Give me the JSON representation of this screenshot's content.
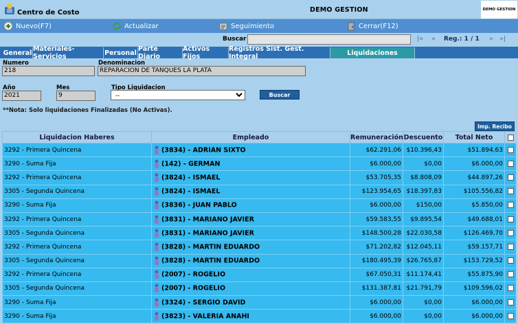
{
  "window": {
    "title": "Centro de Costo",
    "center_title": "DEMO GESTION",
    "brand": "DEMO GESTION"
  },
  "toolbar": {
    "nuevo": "Nuevo(F7)",
    "actualizar": "Actualizar",
    "seguimiento": "Seguimiento",
    "cerrar": "Cerrar(F12)"
  },
  "search": {
    "label": "Buscar",
    "value": "",
    "first": "|«",
    "prev": "«",
    "next": "»",
    "last": "»|",
    "reg": "Reg.: 1 / 1"
  },
  "tabs": [
    "General",
    "Materiales-Servicios",
    "Personal",
    "Parte Diario",
    "Activos Fijos",
    "Registros Sist. Gest. Integral",
    "Liquidaciones"
  ],
  "form": {
    "numero_label": "Numero",
    "numero": "218",
    "denominacion_label": "Denominacion",
    "denominacion": "REPARACION DE TANQUES LA PLATA",
    "anio_label": "Año",
    "anio": "2021",
    "mes_label": "Mes",
    "mes": "9",
    "tipo_label": "Tipo Liquidacion",
    "tipo": "--",
    "buscar": "Buscar",
    "nota": "**Nota: Solo liquidaciones Finalizadas (No Activas).",
    "imp_recibo": "Imp. Recibo"
  },
  "table": {
    "headers": [
      "Liquidacion Haberes",
      "Empleado",
      "Remuneración",
      "Descuento",
      "Total Neto"
    ],
    "rows": [
      {
        "liq": "3292 - Primera Quincena",
        "emp": "(3834) - ADRIAN SIXTO",
        "rem": "$62.291,06",
        "desc": "$10.396,43",
        "neto": "$51.894,63"
      },
      {
        "liq": "3290 - Suma Fija",
        "emp": "(142) - GERMAN",
        "rem": "$6.000,00",
        "desc": "$0,00",
        "neto": "$6.000,00"
      },
      {
        "liq": "3292 - Primera Quincena",
        "emp": "(3824) - ISMAEL",
        "rem": "$53.705,35",
        "desc": "$8.808,09",
        "neto": "$44.897,26"
      },
      {
        "liq": "3305 - Segunda Quincena",
        "emp": "(3824) - ISMAEL",
        "rem": "$123.954,65",
        "desc": "$18.397,83",
        "neto": "$105.556,82"
      },
      {
        "liq": "3290 - Suma Fija",
        "emp": "(3836) - JUAN PABLO",
        "rem": "$6.000,00",
        "desc": "$150,00",
        "neto": "$5.850,00"
      },
      {
        "liq": "3292 - Primera Quincena",
        "emp": "(3831) - MARIANO JAVIER",
        "rem": "$59.583,55",
        "desc": "$9.895,54",
        "neto": "$49.688,01"
      },
      {
        "liq": "3305 - Segunda Quincena",
        "emp": "(3831) - MARIANO JAVIER",
        "rem": "$148.500,28",
        "desc": "$22.030,58",
        "neto": "$126.469,70"
      },
      {
        "liq": "3292 - Primera Quincena",
        "emp": "(3828) - MARTIN EDUARDO",
        "rem": "$71.202,82",
        "desc": "$12.045,11",
        "neto": "$59.157,71"
      },
      {
        "liq": "3305 - Segunda Quincena",
        "emp": "(3828) - MARTIN EDUARDO",
        "rem": "$180.495,39",
        "desc": "$26.765,87",
        "neto": "$153.729,52"
      },
      {
        "liq": "3292 - Primera Quincena",
        "emp": "(2007) - ROGELIO",
        "rem": "$67.050,31",
        "desc": "$11.174,41",
        "neto": "$55.875,90"
      },
      {
        "liq": "3305 - Segunda Quincena",
        "emp": "(2007) - ROGELIO",
        "rem": "$131.387,81",
        "desc": "$21.791,79",
        "neto": "$109.596,02"
      },
      {
        "liq": "3290 - Suma Fija",
        "emp": "(3324) - SERGIO DAVID",
        "rem": "$6.000,00",
        "desc": "$0,00",
        "neto": "$6.000,00"
      },
      {
        "liq": "3290 - Suma Fija",
        "emp": "(3823) - VALERIA ANAHI",
        "rem": "$6.000,00",
        "desc": "$0,00",
        "neto": "$6.000,00"
      }
    ]
  }
}
